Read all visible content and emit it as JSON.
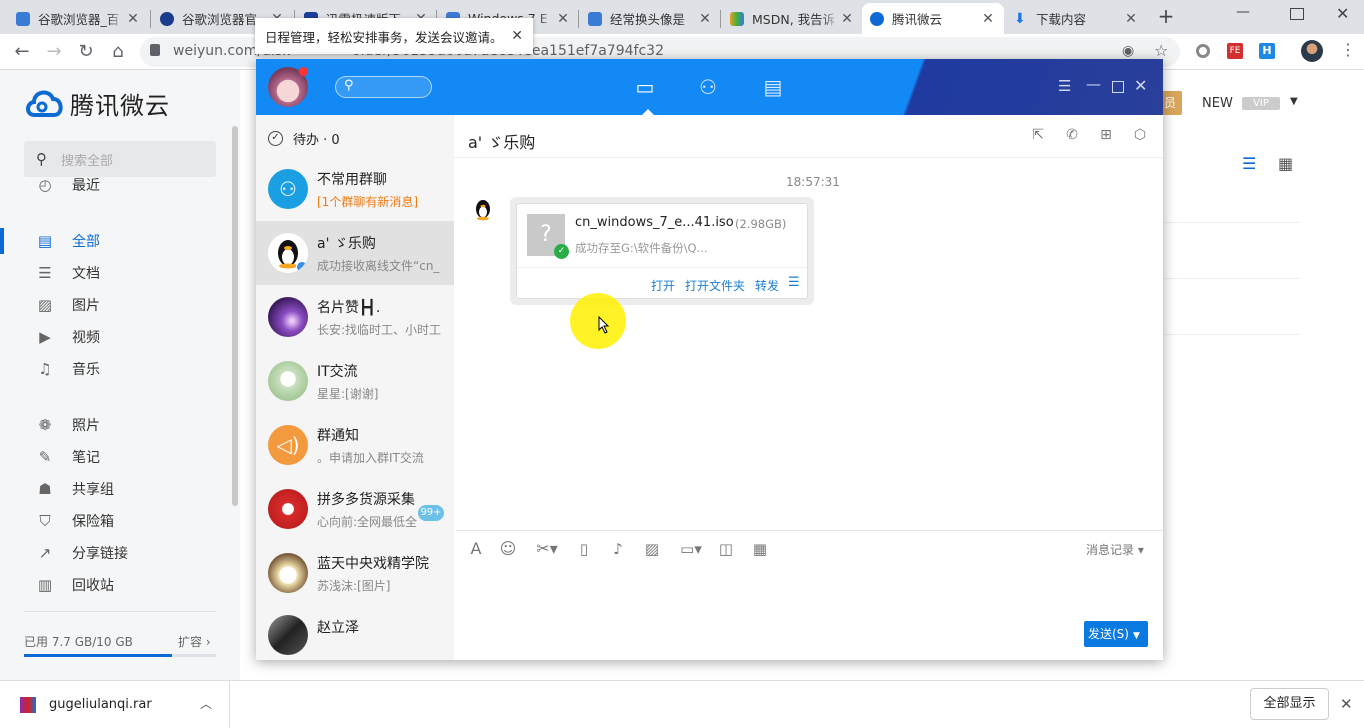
{
  "tabs": [
    {
      "title": "谷歌浏览器_百",
      "color": "#3a7bd5"
    },
    {
      "title": "谷歌浏览器官",
      "color": "#1a3c8c"
    },
    {
      "title": "迅雷极速版下",
      "color": "#1c3c9c"
    },
    {
      "title": "Windows 7 E",
      "color": "#3a7bd5"
    },
    {
      "title": "经常换头像是",
      "color": "#3a7bd5"
    },
    {
      "title": "MSDN, 我告诉",
      "color": "#e8a020"
    },
    {
      "title": "腾讯微云",
      "color": "#0b6ad4"
    },
    {
      "title": "下载内容",
      "color": "#1a73e8"
    }
  ],
  "address": {
    "url_start": "weiyun.com/disk",
    "url_end": "older/56135a66a7aece4eea151ef7a794fc32",
    "popup_text": "日程管理，轻松安排事务，发送会议邀请。"
  },
  "weiyun": {
    "logo_text": "腾讯微云",
    "search_placeholder": "搜索全部",
    "nav": [
      {
        "label": "最近",
        "icon": "clock-icon"
      },
      {
        "label": "全部",
        "icon": "file-list-icon",
        "active": true
      },
      {
        "label": "文档",
        "icon": "stack-icon"
      },
      {
        "label": "图片",
        "icon": "image-icon"
      },
      {
        "label": "视频",
        "icon": "video-icon"
      },
      {
        "label": "音乐",
        "icon": "music-icon"
      },
      {
        "label": "照片",
        "icon": "photo-icon"
      },
      {
        "label": "笔记",
        "icon": "pen-icon"
      },
      {
        "label": "共享组",
        "icon": "group-icon"
      },
      {
        "label": "保险箱",
        "icon": "shield-icon"
      },
      {
        "label": "分享链接",
        "icon": "share-icon"
      },
      {
        "label": "回收站",
        "icon": "trash-icon"
      }
    ],
    "storage_text": "已用 7.7 GB/10 GB",
    "storage_used_fraction": 0.77,
    "expand_label": "扩容",
    "header_new": "NEW",
    "header_vip": "VIP",
    "header_member": "员"
  },
  "qq": {
    "todo": "待办 · 0",
    "conversations": [
      {
        "name": "不常用群聊",
        "sub": "[1个群聊有新消息]",
        "sub_color": "#f07a16",
        "avatar": "group-avatar",
        "bg": "#1a9fe3"
      },
      {
        "name": "a' ゞ乐购",
        "sub": "成功接收离线文件“cn_",
        "avatar": "penguin-avatar",
        "bg": "#ffffff"
      },
      {
        "name": "名片赞┣┫.",
        "sub": "长安:找临时工、小时工",
        "avatar": "galaxy-avatar",
        "bg": "#5b2b8a"
      },
      {
        "name": "IT交流",
        "sub": "星星:[谢谢]",
        "avatar": "anime-avatar",
        "bg": "#c9e0c0"
      },
      {
        "name": "群通知",
        "sub": "。申请加入群IT交流",
        "avatar": "speaker-avatar",
        "bg": "#f29a3d"
      },
      {
        "name": "拼多多货源采集",
        "sub": "心向前:全网最低全",
        "badge": "99+",
        "avatar": "red-avatar",
        "bg": "#d92b2b"
      },
      {
        "name": "蓝天中央戏精学院",
        "sub": "苏浅沫:[图片]",
        "avatar": "cartoon-avatar",
        "bg": "#f3e3b0"
      },
      {
        "name": "赵立泽",
        "sub": "",
        "avatar": "dark-avatar",
        "bg": "#333333"
      }
    ],
    "chat_title": "a' ゞ乐购",
    "timestamp": "18:57:31",
    "file": {
      "name": "cn_windows_7_e...41.iso",
      "size": "(2.98GB)",
      "status": "成功存至G:\\软件备份\\Q...",
      "actions": [
        "打开",
        "打开文件夹",
        "转发"
      ]
    },
    "history_label": "消息记录",
    "send_label": "发送(S)"
  },
  "download": {
    "file_name": "gugeliulanqi.rar",
    "show_all": "全部显示"
  }
}
